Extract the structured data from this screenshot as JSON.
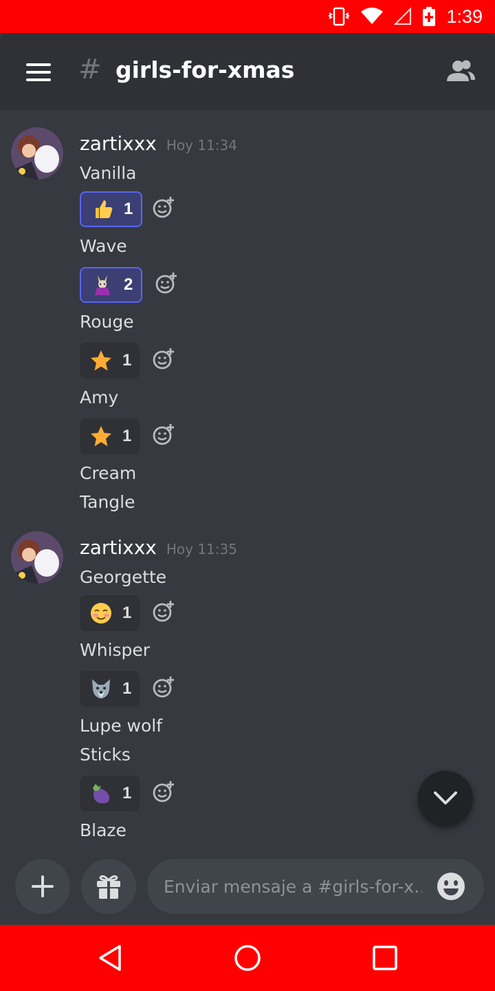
{
  "status_bar": {
    "time": "1:39",
    "icons": [
      "vibrate-icon",
      "wifi-icon",
      "signal-icon",
      "battery-icon"
    ]
  },
  "header": {
    "hash": "#",
    "channel": "girls-for-xmas",
    "menu_icon": "hamburger-menu-icon",
    "members_icon": "members-icon"
  },
  "messages": [
    {
      "author": "zartixxx",
      "timestamp": "Hoy 11:34",
      "lines": [
        "Vanilla",
        "Wave",
        "Rouge",
        "Amy",
        "Cream",
        "Tangle"
      ],
      "reactions": [
        {
          "emoji": "thumbs-up-icon",
          "count": "1",
          "me": true
        },
        {
          "emoji": "wave-swallow-custom-emoji",
          "count": "2",
          "me": true
        },
        {
          "emoji": "star-icon",
          "count": "1",
          "me": false
        },
        {
          "emoji": "star-icon",
          "count": "1",
          "me": false
        }
      ]
    },
    {
      "author": "zartixxx",
      "timestamp": "Hoy 11:35",
      "lines": [
        "Georgette",
        "Whisper",
        "Lupe wolf",
        "Sticks",
        "Blaze"
      ],
      "reactions": [
        {
          "emoji": "blush-face-icon",
          "count": "1",
          "me": false
        },
        {
          "emoji": "wolf-face-icon",
          "count": "1",
          "me": false
        },
        {
          "emoji": "eggplant-icon",
          "count": "1",
          "me": false
        }
      ]
    }
  ],
  "composer": {
    "placeholder": "Enviar mensaje a #girls-for-x…",
    "add_icon": "plus-icon",
    "gift_icon": "gift-icon",
    "emoji_icon": "emoji-face-icon"
  },
  "nav_bar": {
    "icons": [
      "back-triangle-icon",
      "home-circle-icon",
      "recents-square-icon"
    ]
  },
  "colors": {
    "status_bar": "#ff0000",
    "background": "#36393f",
    "header": "#303136",
    "reaction_selected": "#5865f2",
    "timestamp": "#72767d"
  }
}
